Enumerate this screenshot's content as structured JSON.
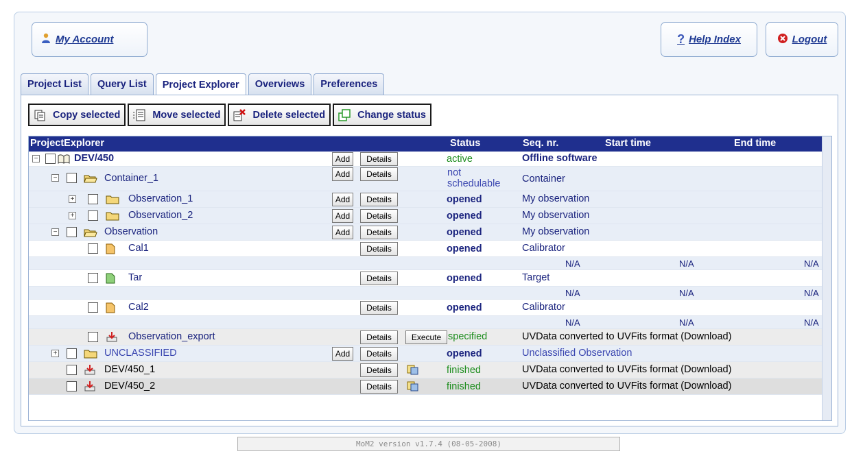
{
  "header": {
    "my_account": "My Account",
    "help_index": "Help Index",
    "logout": "Logout"
  },
  "tabs": [
    {
      "label": "Project List"
    },
    {
      "label": "Query List"
    },
    {
      "label": "Project Explorer"
    },
    {
      "label": "Overviews"
    },
    {
      "label": "Preferences"
    }
  ],
  "active_tab": "Project Explorer",
  "toolbar": {
    "copy": "Copy selected",
    "move": "Move selected",
    "delete": "Delete selected",
    "change_status": "Change status"
  },
  "grid": {
    "headers": {
      "name": "ProjectExplorer",
      "status": "Status",
      "seq": "Seq. nr.",
      "start": "Start time",
      "end": "End time"
    },
    "buttons": {
      "add": "Add",
      "details": "Details",
      "execute": "Execute"
    },
    "rows": [
      {
        "name": "DEV/450",
        "status": "active",
        "desc": "Offline software"
      },
      {
        "name": "Container_1",
        "status": "not schedulable",
        "desc": "Container"
      },
      {
        "name": "Observation_1",
        "status": "opened",
        "desc": "My observation"
      },
      {
        "name": "Observation_2",
        "status": "opened",
        "desc": "My observation"
      },
      {
        "name": "Observation",
        "status": "opened",
        "desc": "My observation"
      },
      {
        "name": "Cal1",
        "status": "opened",
        "desc": "Calibrator",
        "times": [
          "N/A",
          "N/A",
          "N/A"
        ]
      },
      {
        "name": "Tar",
        "status": "opened",
        "desc": "Target",
        "times": [
          "N/A",
          "N/A",
          "N/A"
        ]
      },
      {
        "name": "Cal2",
        "status": "opened",
        "desc": "Calibrator",
        "times": [
          "N/A",
          "N/A",
          "N/A"
        ]
      },
      {
        "name": "Observation_export",
        "status": "specified",
        "desc": "UVData converted to UVFits format (Download)"
      },
      {
        "name": "UNCLASSIFIED",
        "status": "opened",
        "desc": "Unclassified Observation"
      },
      {
        "name": "DEV/450_1",
        "status": "finished",
        "desc": "UVData converted to UVFits format (Download)"
      },
      {
        "name": "DEV/450_2",
        "status": "finished",
        "desc": "UVData converted to UVFits format (Download)"
      }
    ]
  },
  "footer": {
    "version": "MoM2 version v1.7.4 (08-05-2008)"
  },
  "colors": {
    "header_bg": "#1f2f8e",
    "link": "#1f3a93",
    "status_green": "#1c8c1c"
  }
}
